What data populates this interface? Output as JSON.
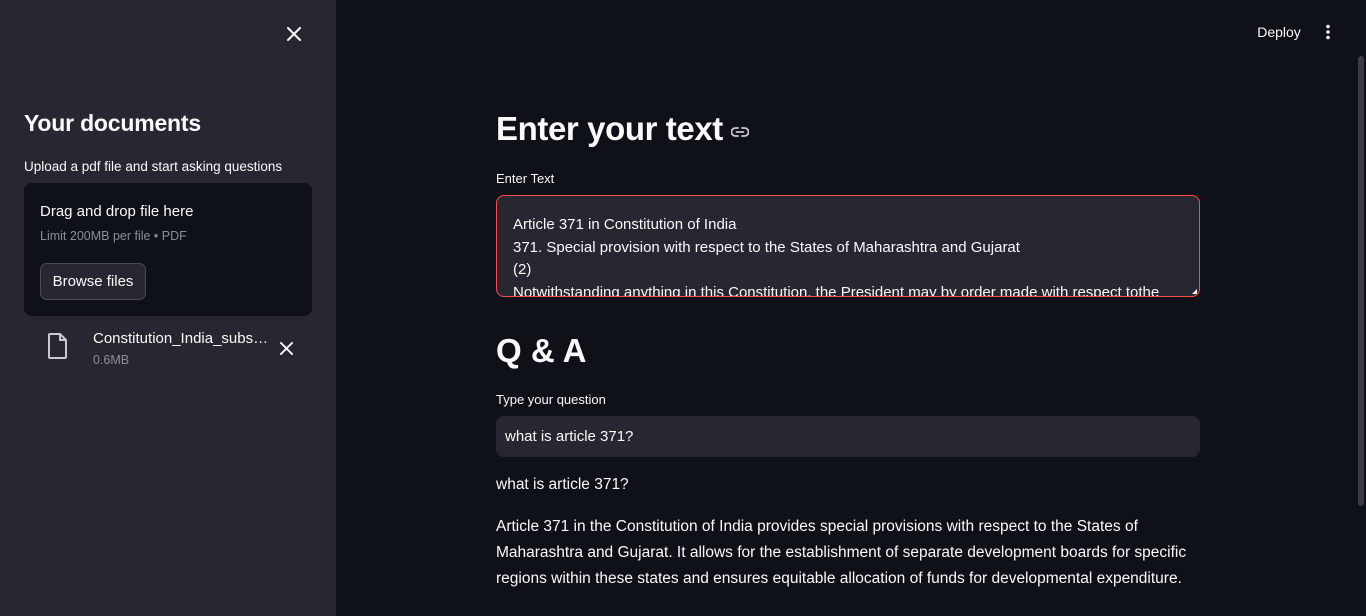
{
  "sidebar": {
    "title": "Your documents",
    "upload_label": "Upload a pdf file and start asking questions",
    "dropzone": {
      "title": "Drag and drop file here",
      "limit": "Limit 200MB per file • PDF",
      "browse_label": "Browse files"
    },
    "file": {
      "name": "Constitution_India_subset.pdf",
      "size": "0.6MB"
    }
  },
  "header": {
    "deploy_label": "Deploy",
    "menu_icon": "vertical-dots-icon"
  },
  "main": {
    "title": "Enter your text",
    "text_label": "Enter Text",
    "text_lines": [
      "Article 371 in Constitution of India",
      "371. Special provision with respect to the States of Maharashtra and Gujarat",
      "(2)",
      "Notwithstanding anything in this Constitution, the President may by order made with respect tothe"
    ],
    "qa_title": "Q & A",
    "question_label": "Type your question",
    "question_value": "what is article 371?",
    "echo_question": "what is article 371?",
    "answer_lines": [
      "Article 371 in the Constitution of India provides special provisions with respect to the States of",
      "Maharashtra and Gujarat. It allows for the establishment of separate development boards for specific",
      "regions within these states and ensures equitable allocation of funds for developmental expenditure."
    ]
  },
  "colors": {
    "background": "#0e1117",
    "sidebar": "#262730",
    "accent_focus": "#ff4b4b",
    "muted_text": "#8b8d94"
  }
}
